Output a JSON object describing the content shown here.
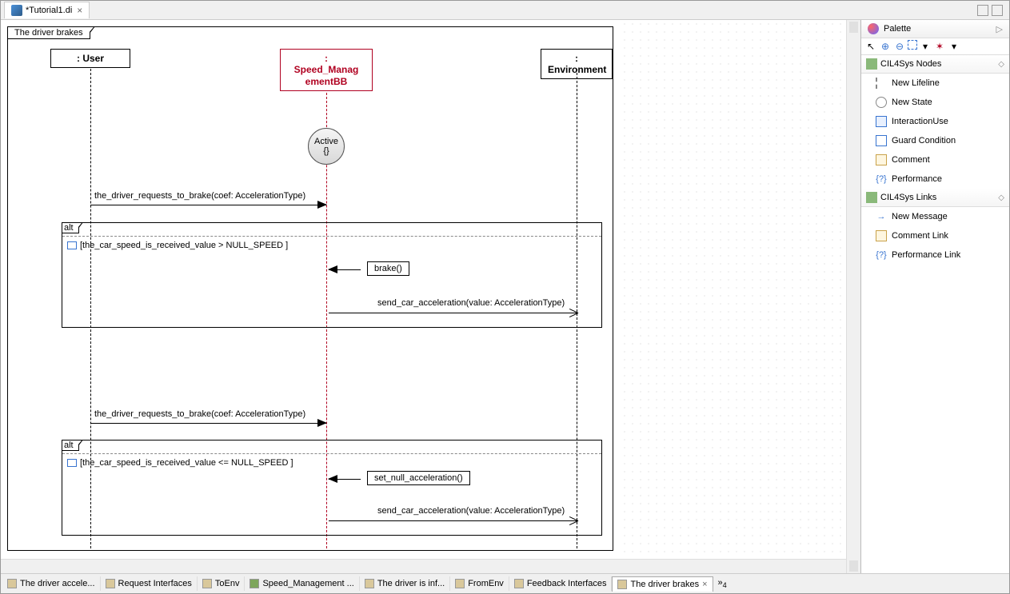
{
  "topTab": {
    "title": "*Tutorial1.di"
  },
  "palette": {
    "title": "Palette",
    "sections": [
      {
        "title": "CIL4Sys Nodes",
        "items": [
          "New Lifeline",
          "New State",
          "InteractionUse",
          "Guard Condition",
          "Comment",
          "Performance"
        ]
      },
      {
        "title": "CIL4Sys Links",
        "items": [
          "New Message",
          "Comment Link",
          "Performance Link"
        ]
      }
    ]
  },
  "frame": {
    "label": "The driver brakes"
  },
  "lifelines": {
    "user": ": User",
    "speed": ": Speed_ManagementBB",
    "env": ": Environment"
  },
  "state": {
    "name": "Active",
    "body": "{}"
  },
  "messages": {
    "m1": "the_driver_requests_to_brake(coef: AccelerationType)",
    "m2": "brake()",
    "m3": "send_car_acceleration(value: AccelerationType)",
    "m4": "the_driver_requests_to_brake(coef: AccelerationType)",
    "m5": "set_null_acceleration()",
    "m6": "send_car_acceleration(value: AccelerationType)"
  },
  "alts": {
    "label": "alt",
    "g1": "[the_car_speed_is_received_value > NULL_SPEED  ]",
    "g2": "[the_car_speed_is_received_value <= NULL_SPEED  ]"
  },
  "bottomTabs": [
    {
      "label": "The driver accele..."
    },
    {
      "label": "Request Interfaces"
    },
    {
      "label": "ToEnv"
    },
    {
      "label": "Speed_Management ...",
      "highlighted": true
    },
    {
      "label": "The driver is inf..."
    },
    {
      "label": "FromEnv"
    },
    {
      "label": "Feedback Interfaces"
    },
    {
      "label": "The driver brakes",
      "active": true
    }
  ]
}
